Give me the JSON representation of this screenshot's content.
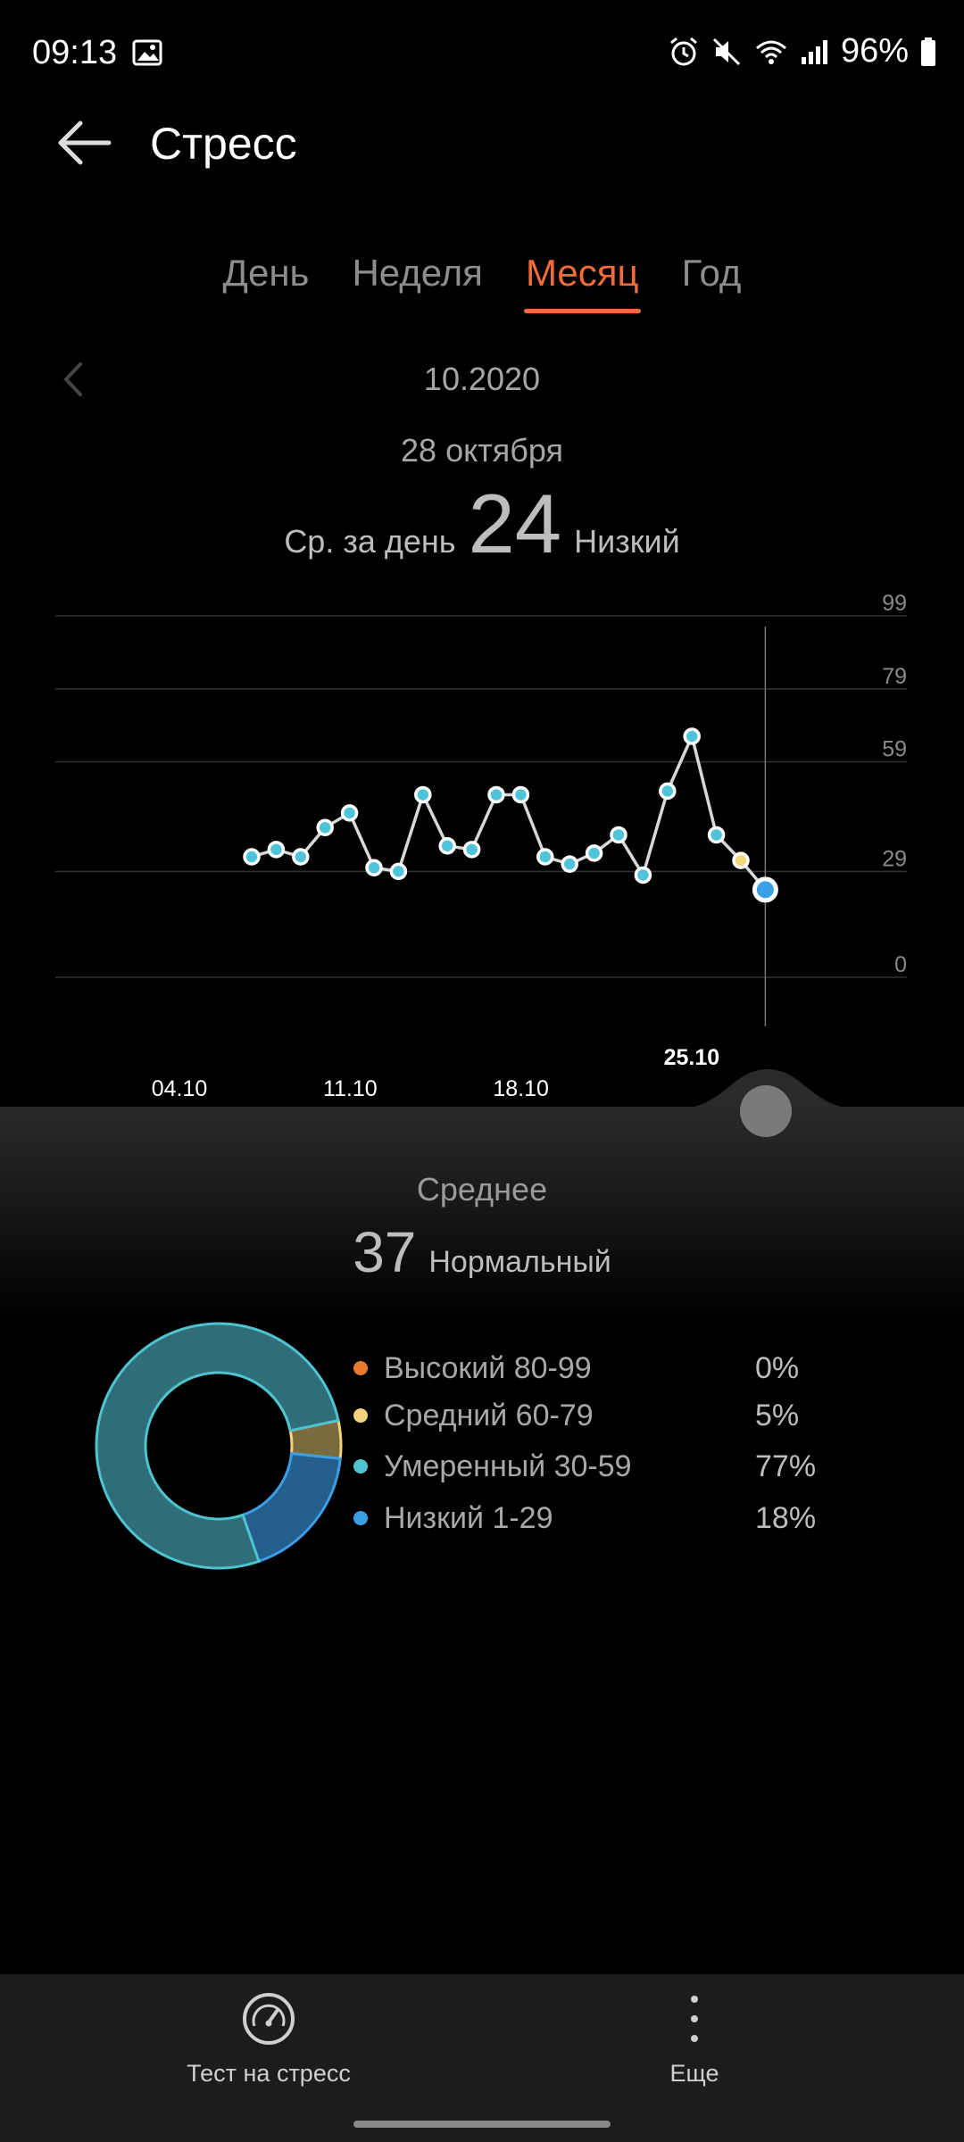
{
  "status_bar": {
    "time": "09:13",
    "battery": "96%"
  },
  "header": {
    "title": "Стресс"
  },
  "tabs": [
    {
      "label": "День",
      "active": false
    },
    {
      "label": "Неделя",
      "active": false
    },
    {
      "label": "Месяц",
      "active": true
    },
    {
      "label": "Год",
      "active": false
    }
  ],
  "period": "10.2020",
  "selected": {
    "date": "28 октября",
    "label": "Ср. за день",
    "value": "24",
    "level": "Низкий"
  },
  "chart_data": {
    "type": "line",
    "title": "",
    "xlabel": "",
    "ylabel": "",
    "y_ticks": [
      "99",
      "79",
      "59",
      "29",
      "0"
    ],
    "ylim": [
      0,
      99
    ],
    "x_tick_labels": [
      "04.10",
      "11.10",
      "18.10",
      "25.10"
    ],
    "highlighted_x_label": "25.10",
    "series": [
      {
        "x": [
          9,
          10,
          11,
          12,
          13,
          14,
          15,
          16,
          17,
          18,
          19,
          20,
          21,
          22,
          23,
          24,
          25,
          26,
          27,
          28,
          29,
          30
        ],
        "values": [
          33,
          35,
          33,
          41,
          45,
          30,
          29,
          50,
          36,
          35,
          50,
          50,
          33,
          31,
          34,
          39,
          28,
          51,
          66,
          39,
          32,
          24
        ]
      }
    ],
    "highlighted_point": {
      "x": 29,
      "value": 66
    },
    "selected_point": {
      "x": 30,
      "value": 24
    },
    "colors": {
      "line": "#d8d8d8",
      "point": "#4fc3d9",
      "highlight": "#f5d77c",
      "selected": "#3aa0e8"
    }
  },
  "average": {
    "title": "Среднее",
    "value": "37",
    "level": "Нормальный"
  },
  "distribution": [
    {
      "label": "Высокий 80-99",
      "pct": "0%",
      "value": 0,
      "color": "#e8792e"
    },
    {
      "label": "Средний 60-79",
      "pct": "5%",
      "value": 5,
      "color": "#f2d37a"
    },
    {
      "label": "Умеренный 30-59",
      "pct": "77%",
      "value": 77,
      "color": "#4fc4d0"
    },
    {
      "label": "Низкий 1-29",
      "pct": "18%",
      "value": 18,
      "color": "#3b9fe6"
    }
  ],
  "bottom_bar": {
    "stress_test_label": "Тест на стресс",
    "more_label": "Еще"
  }
}
